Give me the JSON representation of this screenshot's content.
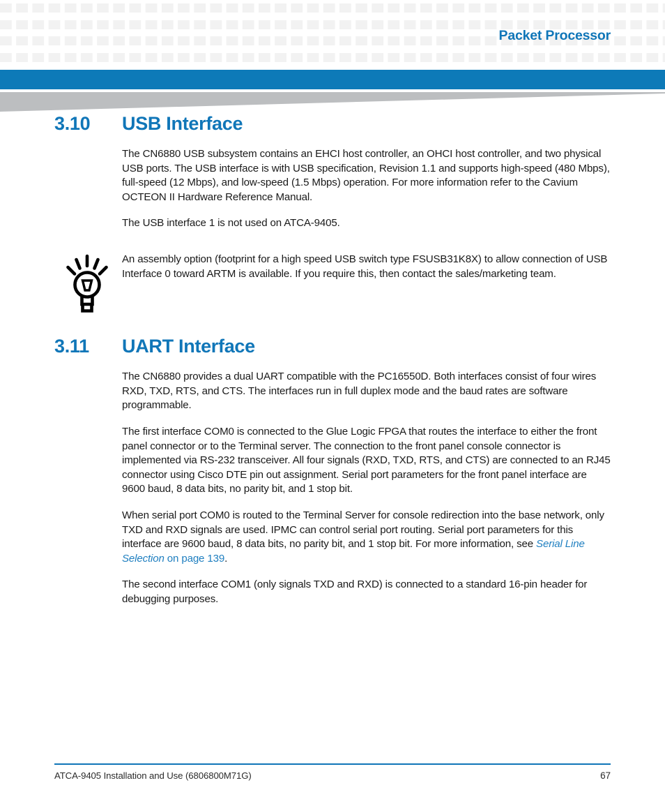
{
  "header": {
    "title": "Packet Processor",
    "accent_color": "#0d7ab8",
    "title_color": "#1076b8",
    "wedge_color": "#bcbec0",
    "grid_cell_color": "#f2f2f2"
  },
  "sections": [
    {
      "number": "3.10",
      "title": "USB Interface",
      "paragraphs": [
        "The CN6880 USB subsystem contains an EHCI host controller, an OHCI host controller, and two physical USB ports. The USB interface is with USB specification, Revision 1.1 and supports high-speed (480 Mbps), full-speed (12 Mbps), and low-speed (1.5 Mbps) operation. For more information refer to the Cavium OCTEON II Hardware Reference Manual.",
        "The USB interface 1 is not used on ATCA-9405."
      ],
      "note": {
        "icon": "lightbulb-tip-icon",
        "text": "An assembly option (footprint for a high speed USB switch type FSUSB31K8X)  to allow connection of USB Interface 0 toward ARTM is available. If you require this, then contact the sales/marketing team."
      }
    },
    {
      "number": "3.11",
      "title": "UART Interface",
      "paragraphs": [
        "The CN6880 provides a dual UART compatible with the PC16550D. Both interfaces consist of four wires RXD, TXD, RTS, and CTS. The interfaces run in full duplex mode and the baud rates are software programmable.",
        "The first interface COM0 is connected to the Glue Logic FPGA that routes the interface to either the front panel connector or to the Terminal server. The connection to the front panel console connector is implemented via RS-232 transceiver. All four signals (RXD, TXD, RTS, and CTS) are connected to an RJ45 connector using Cisco DTE pin out assignment. Serial port parameters for the front panel interface are 9600 baud, 8 data bits, no parity bit, and 1 stop bit."
      ],
      "xref_paragraph": {
        "lead": "When serial port COM0 is routed to the Terminal Server for console redirection into the base network, only TXD and RXD signals are used. IPMC can control serial port routing. Serial port parameters for this interface are 9600 baud, 8 data bits, no parity bit, and 1 stop bit. For more information, see ",
        "link_title": "Serial Line Selection",
        "link_tail": " on page 139",
        "trail": "."
      },
      "last_paragraph": "The second interface COM1 (only signals TXD and RXD) is connected to a standard 16-pin header for debugging purposes."
    }
  ],
  "footer": {
    "document": "ATCA-9405 Installation and Use (6806800M71G)",
    "page_number": "67",
    "rule_color": "#1076b8"
  }
}
